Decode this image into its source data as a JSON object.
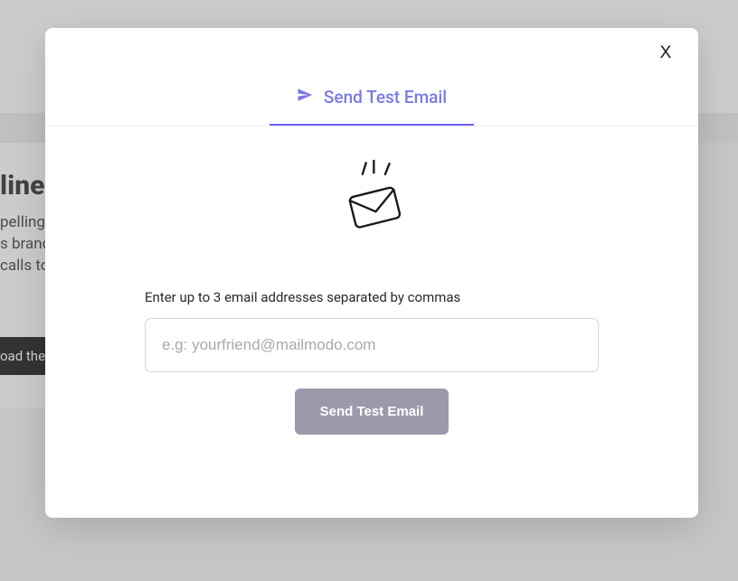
{
  "background": {
    "headline_fragment": "line",
    "copy_fragment": "pelling\ns brand\ncalls to",
    "button_fragment": "oad the"
  },
  "modal": {
    "close_glyph": "X",
    "tab_label": "Send Test Email",
    "instruction": "Enter up to 3 email addresses separated by commas",
    "input_placeholder": "e.g: yourfriend@mailmodo.com",
    "input_value": "",
    "submit_label": "Send Test Email"
  }
}
